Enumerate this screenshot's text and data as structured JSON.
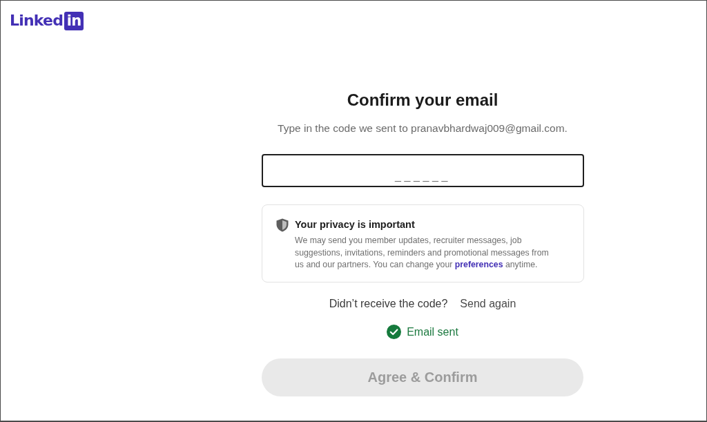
{
  "header": {
    "logo": {
      "wordmark": "Linked",
      "badge": "in"
    }
  },
  "form": {
    "title": "Confirm your email",
    "instructions": "Type in the code we sent to pranavbhardwaj009@gmail.com.",
    "code_field": {
      "placeholder": "______",
      "focused": true
    },
    "privacy_notice": {
      "title": "Your privacy is important",
      "body_before_link": "We may send you member updates, recruiter messages, job suggestions, invitations, reminders and promotional messages from us and our partners. You can change your",
      "link": "preferences",
      "body_after_link": "anytime."
    },
    "resend": {
      "prompt": "Didn’t receive the code?",
      "action": "Send again"
    },
    "status": {
      "text": "Email sent"
    },
    "submit_button": {
      "label": "Agree & Confirm",
      "disabled": true
    }
  }
}
